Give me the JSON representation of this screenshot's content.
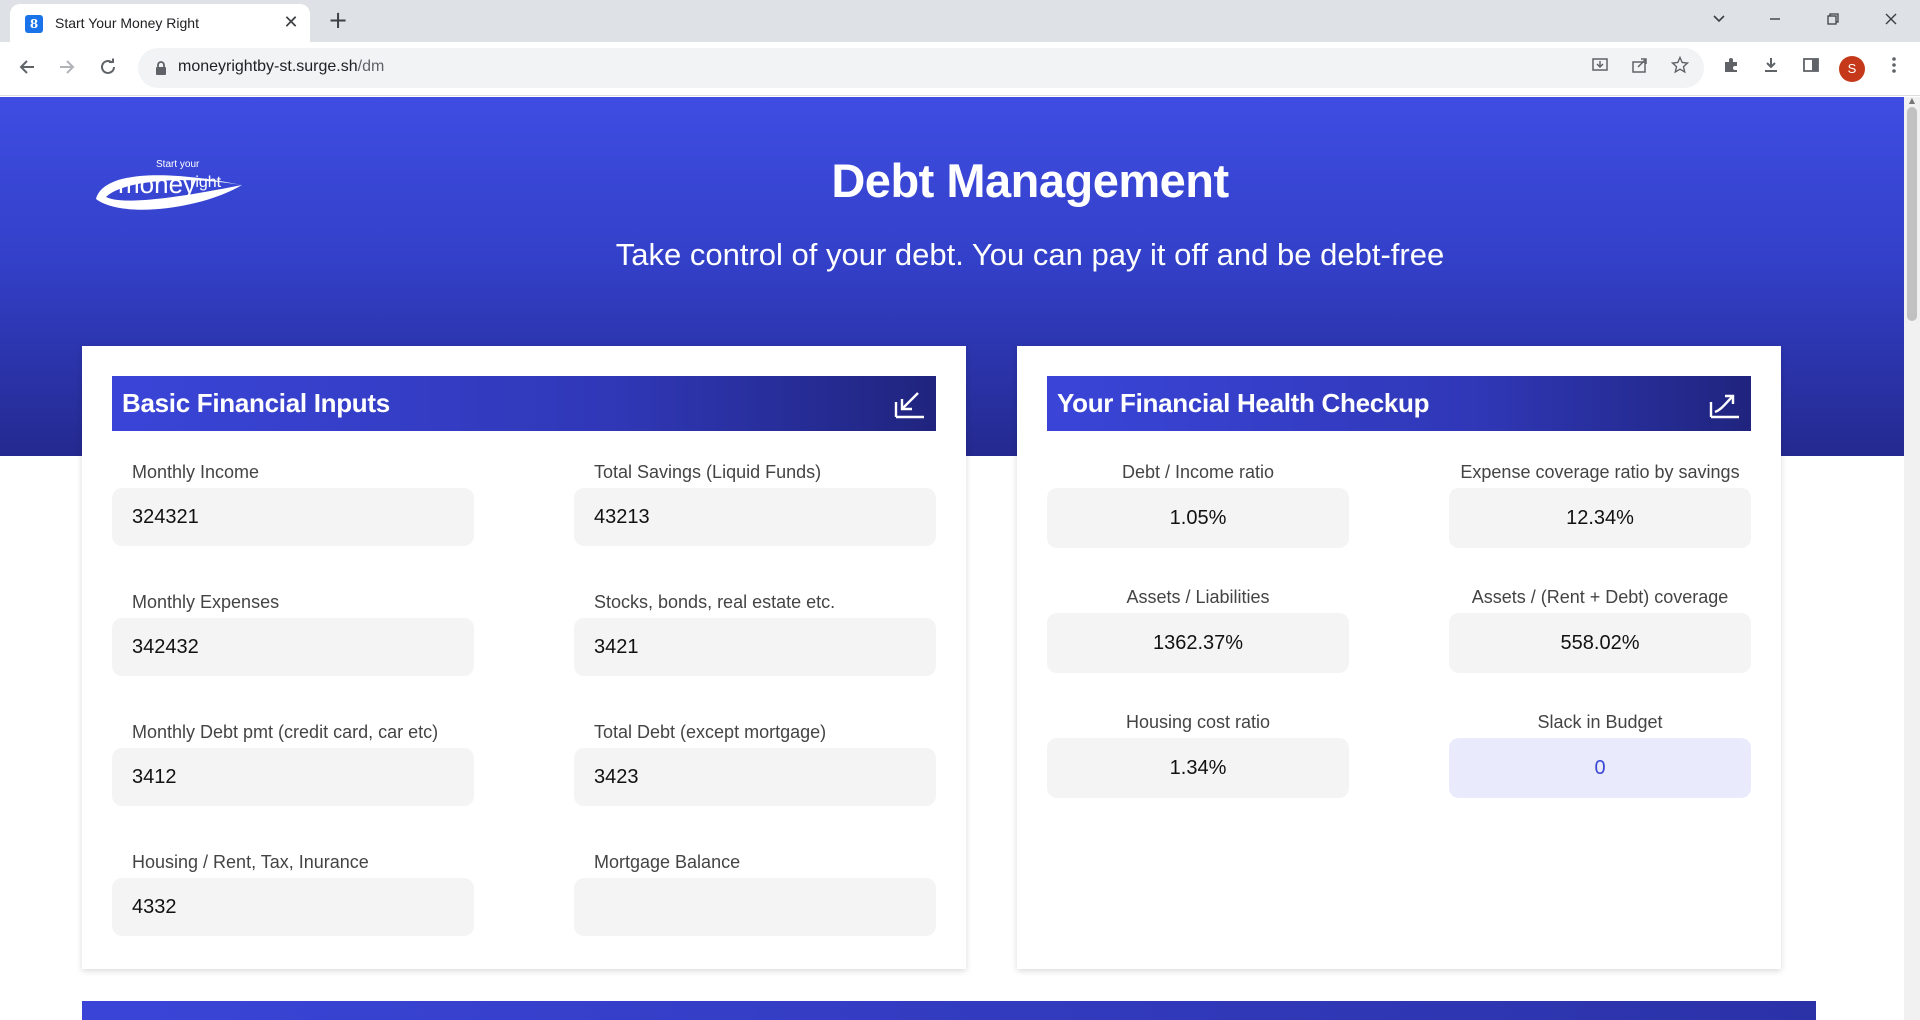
{
  "browser": {
    "tab_title": "Start Your Money Right",
    "favicon_glyph": "8",
    "url_host": "moneyrightby-st.surge.sh",
    "url_path": "/dm",
    "profile_initial": "S",
    "new_tab_glyph": "+",
    "close_glyph": "✕"
  },
  "hero": {
    "title": "Debt Management",
    "subtitle": "Take control of your debt. You can pay it off and be debt-free",
    "logo_small": "Start your",
    "logo_main": "money",
    "logo_tail": "right"
  },
  "inputs_card": {
    "title": "Basic Financial Inputs",
    "icon": "arrow-down-left-icon",
    "fields": [
      {
        "label": "Monthly Income",
        "value": "324321"
      },
      {
        "label": "Total Savings (Liquid Funds)",
        "value": "43213"
      },
      {
        "label": "Monthly Expenses",
        "value": "342432"
      },
      {
        "label": "Stocks, bonds, real estate etc.",
        "value": "3421"
      },
      {
        "label": "Monthly Debt pmt (credit card, car etc)",
        "value": "3412"
      },
      {
        "label": "Total Debt (except mortgage)",
        "value": "3423"
      },
      {
        "label": "Housing / Rent, Tax, Inurance",
        "value": "4332"
      },
      {
        "label": "Mortgage Balance",
        "value": ""
      }
    ]
  },
  "health_card": {
    "title": "Your Financial Health Checkup",
    "icon": "trend-up-icon",
    "metrics": [
      {
        "label": "Debt / Income ratio",
        "value": "1.05%"
      },
      {
        "label": "Expense coverage ratio by savings",
        "value": "12.34%"
      },
      {
        "label": "Assets / Liabilities",
        "value": "1362.37%"
      },
      {
        "label": "Assets / (Rent + Debt) coverage",
        "value": "558.02%"
      },
      {
        "label": "Housing cost ratio",
        "value": "1.34%"
      },
      {
        "label": "Slack in Budget",
        "value": "0"
      }
    ]
  },
  "colors": {
    "hero_top": "#3f4de2",
    "hero_bottom": "#24298f",
    "slack_text": "#3a47d5"
  }
}
